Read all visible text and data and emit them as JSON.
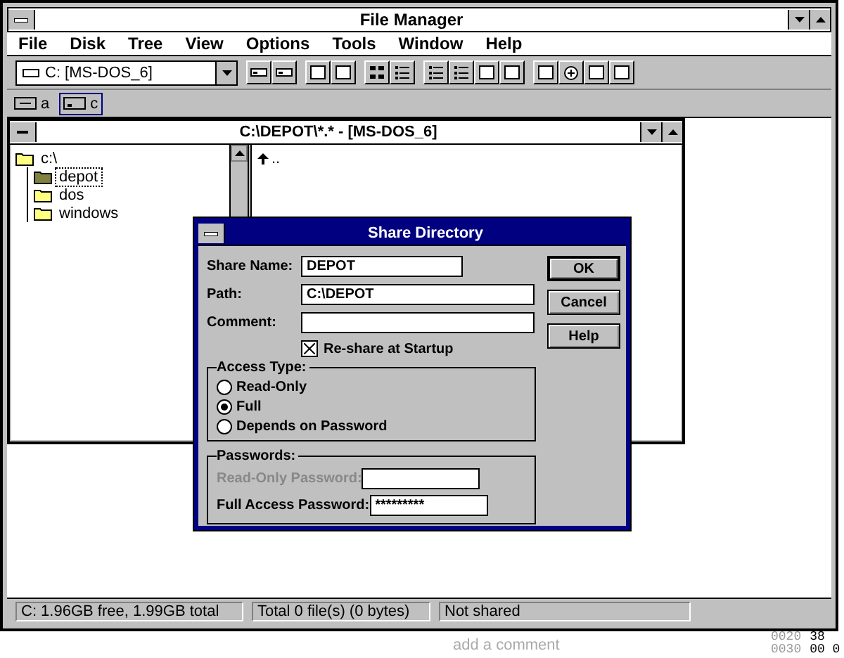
{
  "window": {
    "title": "File Manager"
  },
  "menu": [
    "File",
    "Disk",
    "Tree",
    "View",
    "Options",
    "Tools",
    "Window",
    "Help"
  ],
  "toolbar": {
    "drive_select": "C: [MS-DOS_6]",
    "groups": [
      [
        {
          "kind": "drive"
        },
        {
          "kind": "drive"
        }
      ],
      [
        {
          "kind": "page"
        },
        {
          "kind": "page"
        }
      ],
      [
        {
          "kind": "grid"
        },
        {
          "kind": "list"
        }
      ],
      [
        {
          "kind": "list"
        },
        {
          "kind": "list"
        },
        {
          "kind": "page"
        },
        {
          "kind": "page"
        }
      ],
      [
        {
          "kind": "page"
        },
        {
          "kind": "add"
        },
        {
          "kind": "page"
        },
        {
          "kind": "page"
        }
      ]
    ]
  },
  "drives": [
    {
      "label": "a",
      "kind": "floppy",
      "selected": false
    },
    {
      "label": "c",
      "kind": "hard",
      "selected": true
    }
  ],
  "child_window": {
    "title": "C:\\DEPOT\\*.* - [MS-DOS_6]",
    "tree": [
      {
        "label": "c:\\",
        "selected": false,
        "children": [
          {
            "label": "depot",
            "selected": true
          },
          {
            "label": "dos",
            "selected": false
          },
          {
            "label": "windows",
            "selected": false
          }
        ]
      }
    ],
    "files": [
      {
        "label": ".."
      }
    ]
  },
  "dialog": {
    "title": "Share Directory",
    "fields": [
      {
        "label": "Share Name:",
        "value": "DEPOT"
      },
      {
        "label": "Path:",
        "value": "C:\\DEPOT"
      },
      {
        "label": "Comment:"
      }
    ],
    "reshare": {
      "label": "Re-share at Startup",
      "checked": true
    },
    "access_type": {
      "title": "Access Type:",
      "options": [
        {
          "label": "Read-Only",
          "selected": false
        },
        {
          "label": "Full",
          "selected": true
        },
        {
          "label": "Depends on Password",
          "selected": false
        }
      ]
    },
    "passwords": {
      "title": "Passwords:",
      "fields": [
        {
          "label": "Read-Only Password:",
          "disabled": true
        },
        {
          "label": "Full Access Password:",
          "value": "*********",
          "disabled": false
        }
      ]
    },
    "buttons": [
      {
        "label": "OK",
        "default": true
      },
      {
        "label": "Cancel",
        "default": false
      },
      {
        "label": "Help",
        "default": false
      }
    ]
  },
  "status_bar": [
    "C: 1.96GB free,  1.99GB total",
    "Total 0 file(s) (0 bytes)",
    "Not shared"
  ],
  "background": {
    "link": "add a comment",
    "hex": [
      [
        "0020",
        "38"
      ],
      [
        "0030",
        "00 0"
      ]
    ]
  }
}
